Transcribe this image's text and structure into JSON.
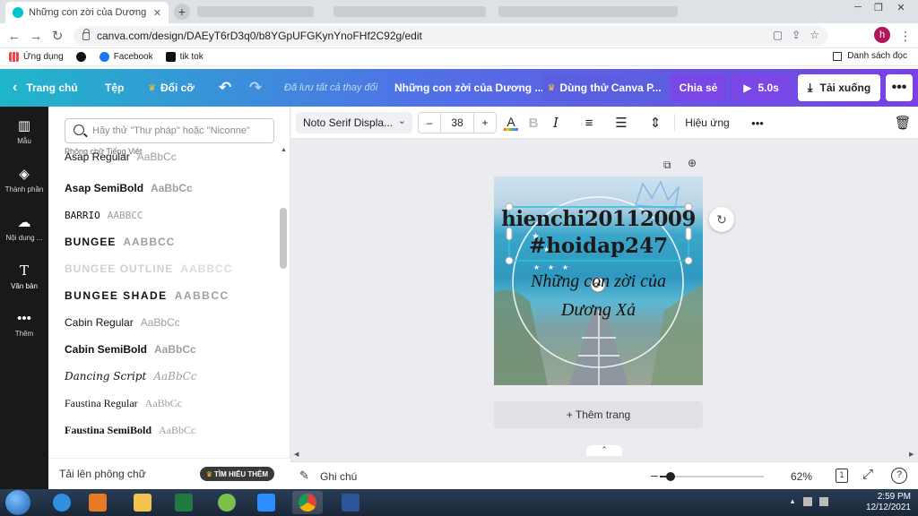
{
  "browser": {
    "active_tab": "Những con zời của Dương Xả - L",
    "url": "canva.com/design/DAEyT6rD3q0/b8YGpUFGKynYnoFHf2C92g/edit",
    "profile_initial": "h",
    "bookmarks": [
      {
        "label": "Ứng dụng"
      },
      {
        "label": ""
      },
      {
        "label": "Facebook"
      },
      {
        "label": "tik tok"
      }
    ],
    "reading_list": "Danh sách đọc"
  },
  "topbar": {
    "home": "Trang chủ",
    "file": "Tệp",
    "resize": "Đổi cỡ",
    "saved_status": "Đã lưu tất cả thay đổi",
    "design_title": "Những con zời của Dương ...",
    "try_pro": "Dùng thử Canva P...",
    "share": "Chia sẻ",
    "play_duration": "5.0s",
    "download": "Tải xuống",
    "colors": {
      "share_bg": "#7a47e6",
      "pro_bg": "#5a5fe0"
    }
  },
  "rail": [
    {
      "label": "Mẫu",
      "icon": "layout-icon"
    },
    {
      "label": "Thành phần",
      "icon": "shapes-icon"
    },
    {
      "label": "Nội dung ...",
      "icon": "upload-icon"
    },
    {
      "label": "Văn bản",
      "icon": "text-icon"
    },
    {
      "label": "Thêm",
      "icon": "more-icon"
    }
  ],
  "panel": {
    "search_placeholder": "Hãy thử \"Thư pháp\" hoặc \"Niconne\"",
    "section_title": "Phông chữ Tiếng Việt",
    "fonts": [
      {
        "name": "Asap Regular",
        "sample": "AaBbCc"
      },
      {
        "name": "Asap SemiBold",
        "sample": "AaBbCc"
      },
      {
        "name": "BARRIO",
        "sample": "AABBCC"
      },
      {
        "name": "BUNGEE",
        "sample": "AABBCC"
      },
      {
        "name": "BUNGEE OUTLINE",
        "sample": "AABBCC"
      },
      {
        "name": "BUNGEE SHADE",
        "sample": "AABBCC"
      },
      {
        "name": "Cabin Regular",
        "sample": "AaBbCc"
      },
      {
        "name": "Cabin SemiBold",
        "sample": "AaBbCc"
      },
      {
        "name": "Dancing Script",
        "sample": "AaBbCc"
      },
      {
        "name": "Faustina Regular",
        "sample": "AaBbCc"
      },
      {
        "name": "Faustina SemiBold",
        "sample": "AaBbCc"
      }
    ],
    "upload_label": "Tải lên phông chữ",
    "learn_more": "TÌM HIỂU THÊM"
  },
  "toolbar": {
    "font_family": "Noto Serif Displa...",
    "font_size": "38",
    "effects": "Hiệu ứng",
    "text_color": "#222222"
  },
  "design": {
    "line1": "hienchi20112009",
    "line2": "#hoidap247",
    "script_line1": "Những con zời của",
    "script_line2": "Dương Xả"
  },
  "canvas": {
    "add_page": "+ Thêm trang",
    "notes": "Ghi chú",
    "zoom": "62%",
    "zoom_fraction": 0.62,
    "page_number": "1"
  },
  "taskbar": {
    "time": "2:59 PM",
    "date": "12/12/2021"
  }
}
